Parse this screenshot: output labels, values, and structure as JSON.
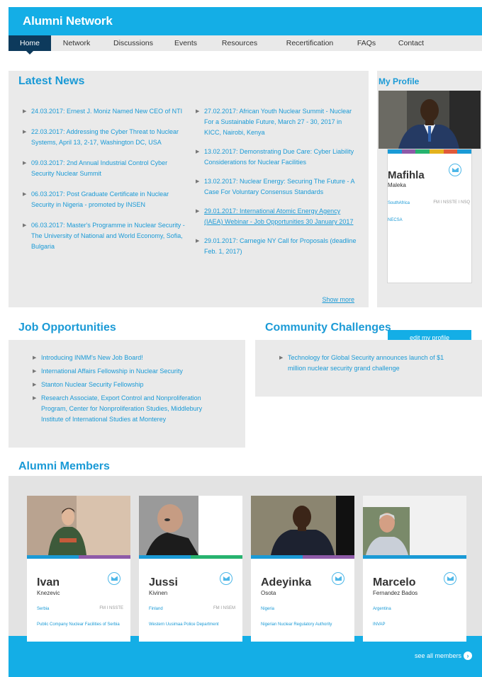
{
  "header": {
    "title": "Alumni Network"
  },
  "nav": {
    "items": [
      {
        "label": "Home",
        "active": true
      },
      {
        "label": "Network"
      },
      {
        "label": "Discussions"
      },
      {
        "label": "Events"
      },
      {
        "label": "Resources"
      },
      {
        "label": "Recertification"
      },
      {
        "label": "FAQs"
      },
      {
        "label": "Contact"
      }
    ]
  },
  "news": {
    "title": "Latest News",
    "left": [
      "24.03.2017: Ernest J. Moniz Named New CEO of NTI",
      "22.03.2017: Addressing the Cyber Threat to Nuclear Systems, April 13, 2-17, Washington DC, USA",
      "09.03.2017: 2nd Annual Industrial Control Cyber Security Nuclear Summit",
      "06.03.2017: Post Graduate Certificate in Nuclear Security in Nigeria - promoted by INSEN",
      "06.03.2017: Master's Programme in Nuclear Security - The University of National and World Economy, Sofia, Bulgaria"
    ],
    "right": [
      "27.02.2017: African Youth Nuclear Summit - Nuclear For a Sustainable Future, March 27 - 30, 2017 in KICC, Nairobi, Kenya",
      "13.02.2017: Demonstrating Due Care: Cyber Liability Considerations for Nuclear Facilities",
      "13.02.2017: Nuclear Energy: Securing The Future - A Case For Voluntary Consensus Standards",
      "29.01.2017: International Atomic Energy Agency (IAEA) Webinar - Job Opportunities 30 January 2017",
      "29.01.2017: Carnegie NY Call for Proposals (deadline Feb. 1, 2017)"
    ],
    "show_more": "Show more"
  },
  "profile": {
    "title": "My Profile",
    "first": "Mafihla",
    "last": "Maleka",
    "country": "SouthAfrica",
    "code": "FM I NSSTE I NSQ",
    "org": "NECSA",
    "edit_label": "edit my profile"
  },
  "jobs": {
    "title": "Job Opportunities",
    "items": [
      "Introducing INMM's New Job Board!",
      "International Affairs Fellowship in Nuclear Security",
      "Stanton Nuclear Security Fellowship",
      "Research Associate, Export Control and Nonproliferation Program, Center for Nonproliferation Studies, Middlebury Institute of International Studies at Monterey"
    ]
  },
  "community": {
    "title": "Community Challenges",
    "items": [
      "Technology for Global Security announces launch of $1 million nuclear security grand challenge"
    ]
  },
  "alumni": {
    "title": "Alumni Members",
    "see_all": "see all members",
    "members": [
      {
        "first": "Ivan",
        "last": "Knezevic",
        "country": "Serbia",
        "code": "FM I NSSTE",
        "org": "Public Company Nuclear Facilities of Serbia"
      },
      {
        "first": "Jussi",
        "last": "Kivinen",
        "country": "Finland",
        "code": "FM I NSEM",
        "org": "Western Uusimaa Police Department"
      },
      {
        "first": "Adeyinka",
        "last": "Osota",
        "country": "Nigeria",
        "code": "",
        "org": "Nigerian Nuclear Regulatory Authority"
      },
      {
        "first": "Marcelo",
        "last": "Fernandez Bados",
        "country": "Argentina",
        "code": "",
        "org": "INVAP"
      }
    ]
  },
  "colors": {
    "brand": "#14aee6",
    "nav_active": "#0d3a5c",
    "link": "#1a9ad6",
    "panel": "#eaeaea"
  },
  "icons": {
    "mail": "mail-icon",
    "arrow": "arrow-right-icon",
    "bullet": "triangle-bullet-icon"
  }
}
